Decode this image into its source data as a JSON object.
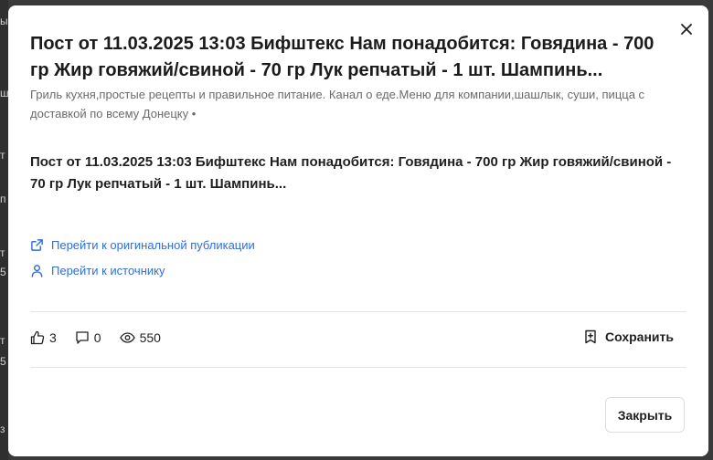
{
  "backdrop": {
    "fragments": [
      "ы",
      "ш",
      "т",
      "п",
      "т",
      "5",
      "т",
      "5",
      "з"
    ]
  },
  "modal": {
    "title": "Пост от 11.03.2025 13:03 Бифштекс Нам понадобится: Говядина - 700 гр Жир говяжий/свиной - 70 гр Лук репчатый - 1 шт. Шампинь...",
    "subtitle": "Гриль кухня,простые рецепты и правильное питание. Канал о еде.Меню для компании,шашлык, суши, пицца с доставкой по всему Донецку •",
    "body": "Пост от 11.03.2025 13:03 Бифштекс Нам понадобится: Говядина - 700 гр Жир говяжий/свиной - 70 гр Лук репчатый - 1 шт. Шампинь...",
    "links": {
      "original": "Перейти к оригинальной публикации",
      "source": "Перейти к источнику"
    },
    "stats": {
      "likes": "3",
      "comments": "0",
      "views": "550"
    },
    "save_label": "Сохранить",
    "close_label": "Закрыть"
  },
  "colors": {
    "link": "#2f6fd6",
    "text": "#1f1f1f",
    "muted": "#6b6b6b"
  },
  "icons": [
    "close-icon",
    "external-link-icon",
    "user-icon",
    "thumbs-up-icon",
    "comment-icon",
    "eye-icon",
    "bookmark-add-icon"
  ]
}
